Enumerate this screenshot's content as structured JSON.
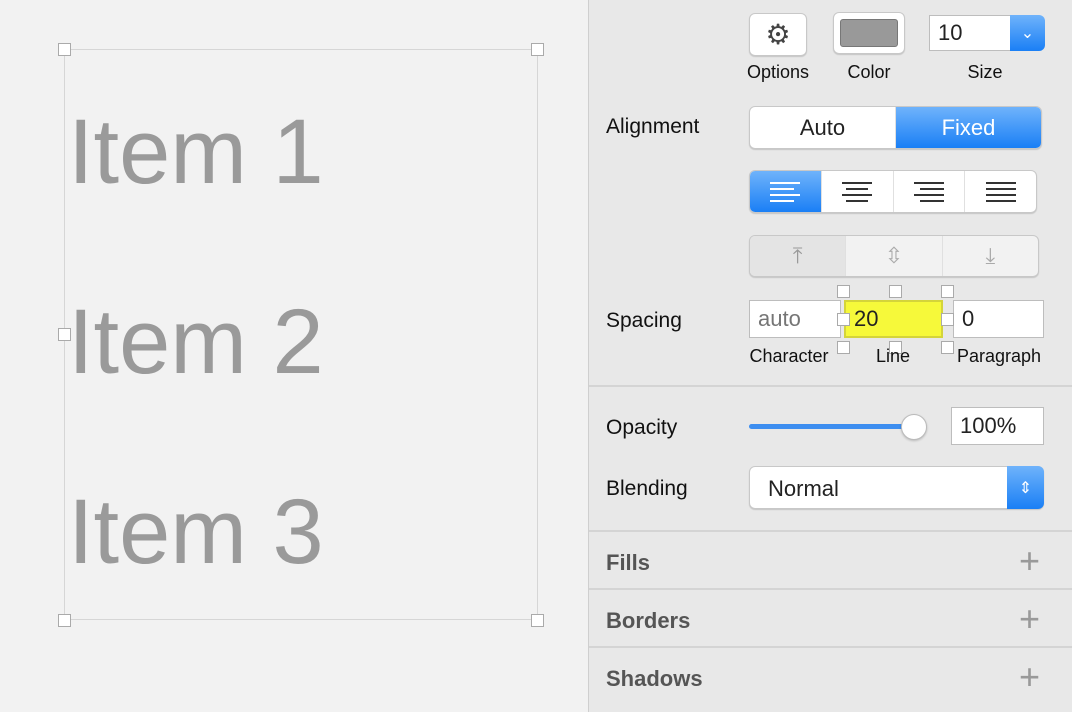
{
  "canvas": {
    "items": [
      "Item 1",
      "Item 2",
      "Item 3"
    ]
  },
  "inspector": {
    "options_label": "Options",
    "options_icon": "gear-icon",
    "color_label": "Color",
    "color_value": "#999999",
    "size_label": "Size",
    "size_value": "10",
    "alignment_label": "Alignment",
    "alignment_modes": [
      {
        "label": "Auto",
        "selected": false
      },
      {
        "label": "Fixed",
        "selected": true
      }
    ],
    "text_align": {
      "options": [
        "left",
        "center",
        "right",
        "justify"
      ],
      "selected": "left"
    },
    "vertical_align": {
      "options": [
        "top",
        "middle",
        "bottom"
      ],
      "selected": "top"
    },
    "spacing_label": "Spacing",
    "spacing": {
      "character": {
        "label": "Character",
        "placeholder": "auto"
      },
      "line": {
        "label": "Line",
        "value": "20"
      },
      "paragraph": {
        "label": "Paragraph",
        "value": "0"
      }
    },
    "opacity_label": "Opacity",
    "opacity_value": "100%",
    "opacity_fraction": 1.0,
    "blending_label": "Blending",
    "blending_value": "Normal",
    "sections": [
      "Fills",
      "Borders",
      "Shadows"
    ]
  },
  "colors": {
    "accent": "#1a7ff5",
    "highlight": "#f6f93a"
  }
}
